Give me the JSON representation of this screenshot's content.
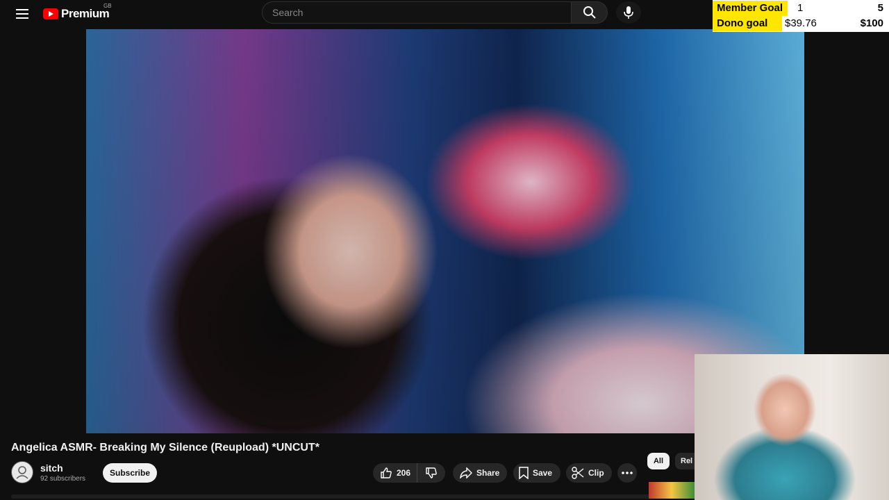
{
  "header": {
    "logo_text": "Premium",
    "region": "GB",
    "search_placeholder": "Search"
  },
  "overlay_goals": {
    "member_goal_label": "Member Goal",
    "member_goal_current": "1",
    "member_goal_target": "5",
    "dono_goal_label": "Dono goal",
    "dono_goal_current": "$39.76",
    "dono_goal_target": "$100"
  },
  "video": {
    "title": "Angelica ASMR- Breaking My Silence (Reupload) *UNCUT*"
  },
  "channel": {
    "name": "sitch",
    "subscribers": "92 subscribers",
    "subscribe_label": "Subscribe"
  },
  "actions": {
    "like_count": "206",
    "share_label": "Share",
    "save_label": "Save",
    "clip_label": "Clip"
  },
  "chips": {
    "all_label": "All",
    "related_label": "Rel"
  },
  "colors": {
    "background": "#0f0f0f",
    "brand_red": "#ff0000",
    "goal_highlight": "#ffe600"
  },
  "icons": [
    "menu-icon",
    "youtube-logo-icon",
    "search-icon",
    "mic-icon",
    "like-icon",
    "dislike-icon",
    "share-icon",
    "save-icon",
    "clip-icon",
    "more-icon"
  ]
}
